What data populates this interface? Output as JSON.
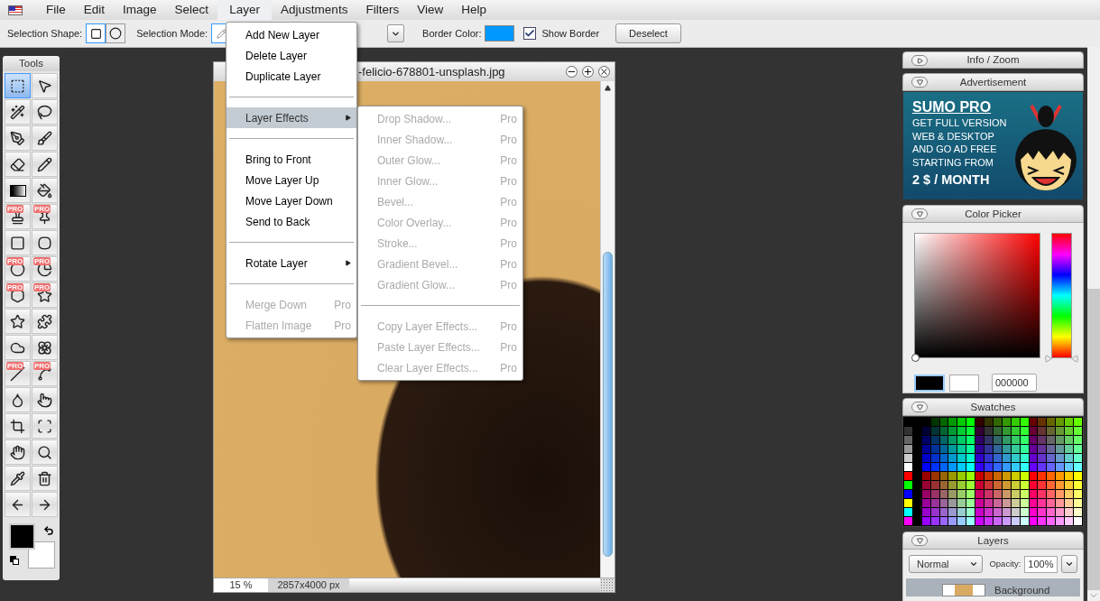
{
  "menubar": [
    {
      "label": "File",
      "selected": false
    },
    {
      "label": "Edit",
      "selected": false
    },
    {
      "label": "Image",
      "selected": false
    },
    {
      "label": "Select",
      "selected": false
    },
    {
      "label": "Layer",
      "selected": true
    },
    {
      "label": "Adjustments",
      "selected": false
    },
    {
      "label": "Filters",
      "selected": false
    },
    {
      "label": "View",
      "selected": false
    },
    {
      "label": "Help",
      "selected": false
    }
  ],
  "toolbar": {
    "shape_label": "Selection Shape:",
    "shapes": [
      {
        "kind": "rect",
        "selected": true
      },
      {
        "kind": "ellipse",
        "selected": false
      }
    ],
    "mode_label": "Selection Mode:",
    "mode_selected": true,
    "border_label": "Border Color:",
    "show_border": {
      "label": "Show Border",
      "checked": true
    },
    "deselect": "Deselect"
  },
  "layer_menu": [
    {
      "kind": "item",
      "label": "Add New Layer",
      "disabled": false
    },
    {
      "kind": "item",
      "label": "Delete Layer",
      "disabled": false
    },
    {
      "kind": "item",
      "label": "Duplicate Layer",
      "disabled": false
    },
    {
      "kind": "separator"
    },
    {
      "kind": "submenu",
      "label": "Layer Effects",
      "selected": true
    },
    {
      "kind": "separator"
    },
    {
      "kind": "item",
      "label": "Bring to Front",
      "disabled": false
    },
    {
      "kind": "item",
      "label": "Move Layer Up",
      "disabled": false
    },
    {
      "kind": "item",
      "label": "Move Layer Down",
      "disabled": false
    },
    {
      "kind": "item",
      "label": "Send to Back",
      "disabled": false
    },
    {
      "kind": "separator"
    },
    {
      "kind": "submenu",
      "label": "Rotate Layer",
      "selected": false
    },
    {
      "kind": "separator"
    },
    {
      "kind": "item",
      "label": "Merge Down",
      "disabled": true,
      "badge": "Pro"
    },
    {
      "kind": "item",
      "label": "Flatten Image",
      "disabled": true,
      "badge": "Pro"
    }
  ],
  "effects_menu": [
    {
      "kind": "item",
      "label": "Drop Shadow...",
      "disabled": true,
      "badge": "Pro"
    },
    {
      "kind": "item",
      "label": "Inner Shadow...",
      "disabled": true,
      "badge": "Pro"
    },
    {
      "kind": "item",
      "label": "Outer Glow...",
      "disabled": true,
      "badge": "Pro"
    },
    {
      "kind": "item",
      "label": "Inner Glow...",
      "disabled": true,
      "badge": "Pro"
    },
    {
      "kind": "item",
      "label": "Bevel...",
      "disabled": true,
      "badge": "Pro"
    },
    {
      "kind": "item",
      "label": "Color Overlay...",
      "disabled": true,
      "badge": "Pro"
    },
    {
      "kind": "item",
      "label": "Stroke...",
      "disabled": true,
      "badge": "Pro"
    },
    {
      "kind": "item",
      "label": "Gradient Bevel...",
      "disabled": true,
      "badge": "Pro"
    },
    {
      "kind": "item",
      "label": "Gradient Glow...",
      "disabled": true,
      "badge": "Pro"
    },
    {
      "kind": "separator"
    },
    {
      "kind": "item",
      "label": "Copy Layer Effects...",
      "disabled": true,
      "badge": "Pro"
    },
    {
      "kind": "item",
      "label": "Paste Layer Effects...",
      "disabled": true,
      "badge": "Pro"
    },
    {
      "kind": "item",
      "label": "Clear Layer Effects...",
      "disabled": true,
      "badge": "Pro"
    }
  ],
  "tools": {
    "title": "Tools",
    "items": [
      {
        "kind": "marquee",
        "selected": true
      },
      {
        "kind": "move",
        "selected": false
      },
      {
        "kind": "wand",
        "selected": false
      },
      {
        "kind": "lasso",
        "selected": false
      },
      {
        "kind": "pen",
        "selected": false
      },
      {
        "kind": "brush",
        "selected": false
      },
      {
        "kind": "eraser",
        "selected": false
      },
      {
        "kind": "pencil",
        "selected": false
      },
      {
        "kind": "gradient",
        "selected": false
      },
      {
        "kind": "bucket",
        "selected": false
      },
      {
        "kind": "stamp",
        "selected": false,
        "badge": "PRO"
      },
      {
        "kind": "pin",
        "selected": false,
        "badge": "PRO"
      },
      {
        "kind": "square",
        "selected": false
      },
      {
        "kind": "squircle",
        "selected": false
      },
      {
        "kind": "circle",
        "selected": false,
        "badge": "PRO"
      },
      {
        "kind": "pie",
        "selected": false,
        "badge": "PRO"
      },
      {
        "kind": "hexagon",
        "selected": false,
        "badge": "PRO"
      },
      {
        "kind": "star",
        "selected": false,
        "badge": "PRO"
      },
      {
        "kind": "star",
        "selected": false
      },
      {
        "kind": "puzzle",
        "selected": false
      },
      {
        "kind": "cloud",
        "selected": false
      },
      {
        "kind": "flower",
        "selected": false
      },
      {
        "kind": "line",
        "selected": false,
        "badge": "PRO"
      },
      {
        "kind": "curve",
        "selected": false,
        "badge": "PRO"
      },
      {
        "kind": "drop",
        "selected": false
      },
      {
        "kind": "pointer",
        "selected": false
      },
      {
        "kind": "crop",
        "selected": false
      },
      {
        "kind": "scan",
        "selected": false
      },
      {
        "kind": "hand",
        "selected": false
      },
      {
        "kind": "zoom",
        "selected": false
      },
      {
        "kind": "pipette",
        "selected": false
      },
      {
        "kind": "trash",
        "selected": false
      },
      {
        "kind": "left",
        "selected": false
      },
      {
        "kind": "right",
        "selected": false
      }
    ]
  },
  "image_window": {
    "title": "-felicio-678801-unsplash.jpg",
    "zoom": "15 %",
    "size": "2857x4000 px"
  },
  "panels": {
    "info": {
      "title": "Info / Zoom",
      "expanded": false
    },
    "ad": {
      "title": "Advertisement",
      "expanded": true,
      "heading": "SUMO PRO",
      "lines": [
        "GET FULL VERSION",
        "WEB & DESKTOP",
        "AND GO AD FREE",
        "STARTING FROM"
      ],
      "price": "2 $ / MONTH"
    },
    "picker": {
      "title": "Color Picker",
      "expanded": true,
      "hue": {
        "level": 0
      },
      "hex": "000000"
    },
    "swatches": {
      "title": "Swatches",
      "expanded": true
    },
    "layers": {
      "title": "Layers",
      "expanded": true,
      "blend": "Normal",
      "opacity_label": "Opacity:",
      "opacity": "100%",
      "layer": "Background"
    }
  }
}
